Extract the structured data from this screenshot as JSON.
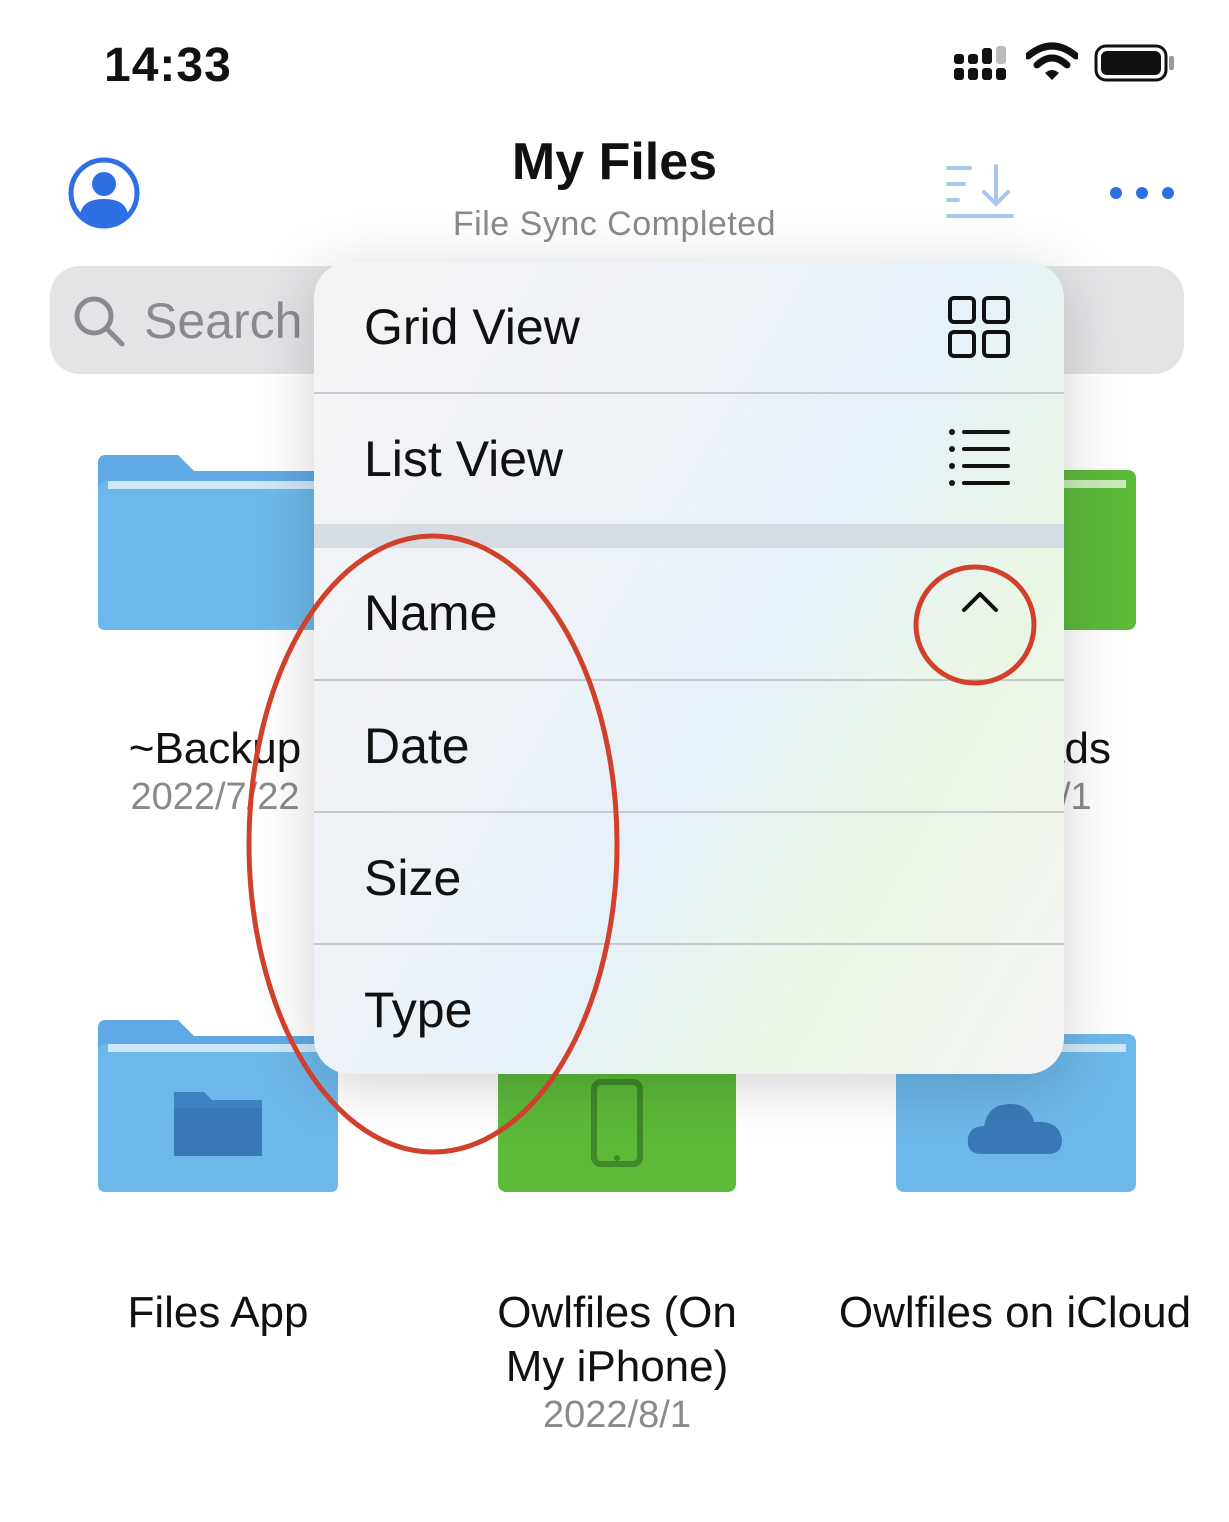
{
  "status_bar": {
    "time": "14:33"
  },
  "header": {
    "title": "My Files",
    "subtitle": "File Sync Completed"
  },
  "search": {
    "placeholder": "Search"
  },
  "folders": [
    {
      "name": "~Backup",
      "date": "2022/7/22"
    },
    {
      "name": "...ads",
      "date": "2022/8/1"
    },
    {
      "name": "Files App",
      "date": ""
    },
    {
      "name": "Owlfiles (On My iPhone)",
      "name_line1": "Owlfiles (On",
      "name_line2": "My iPhone)",
      "date": "2022/8/1"
    },
    {
      "name": "Owlfiles on iCloud",
      "date": ""
    }
  ],
  "menu": {
    "view_options": [
      {
        "label": "Grid View",
        "icon": "grid-icon"
      },
      {
        "label": "List View",
        "icon": "list-icon"
      }
    ],
    "sort_options": [
      {
        "label": "Name",
        "icon": "chevron-up-icon",
        "selected": true
      },
      {
        "label": "Date"
      },
      {
        "label": "Size"
      },
      {
        "label": "Type"
      }
    ]
  },
  "colors": {
    "accent": "#2f6fe4",
    "folder_blue": "#6db8ea",
    "folder_green": "#5cb93a",
    "annotation": "#d0402a"
  }
}
